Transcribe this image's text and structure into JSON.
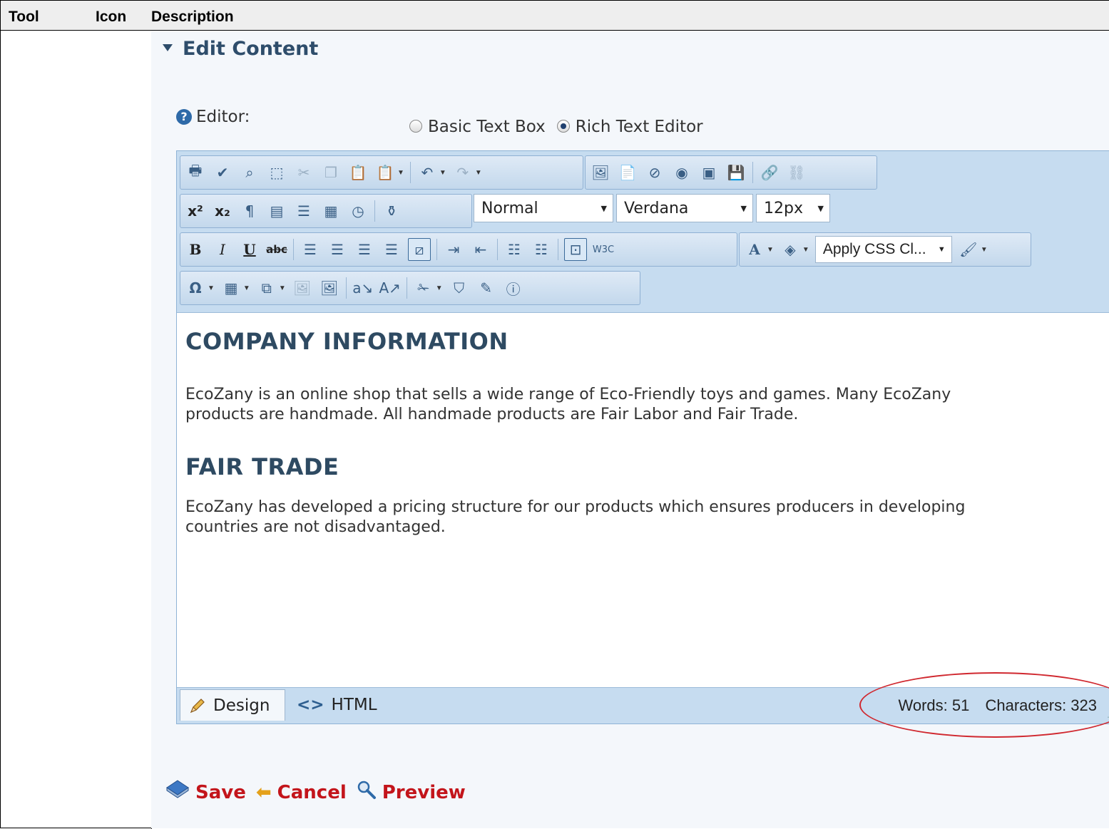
{
  "doc_table": {
    "headers": {
      "tool": "Tool",
      "icon": "Icon",
      "description": "Description"
    }
  },
  "section": {
    "title": "Edit Content"
  },
  "editor_option": {
    "label": "Editor:",
    "options": [
      {
        "label": "Basic Text Box",
        "selected": false
      },
      {
        "label": "Rich Text Editor",
        "selected": true
      }
    ]
  },
  "toolbar": {
    "paragraph_style": "Normal",
    "font_name": "Verdana",
    "font_size": "12px",
    "css_class": "Apply CSS Cl...",
    "bold_label": "B",
    "italic_label": "I",
    "underline_label": "U",
    "strike_label": "abc",
    "font_color_label": "A",
    "omega_label": "Ω"
  },
  "content": {
    "heading1": "COMPANY INFORMATION",
    "para1_line1": "EcoZany is an online shop that sells a wide range of Eco-Friendly toys and games. Many EcoZany",
    "para1_line2": "products are handmade. All handmade products are Fair Labor and Fair Trade.",
    "heading2": "FAIR TRADE",
    "para2_line1": "EcoZany has developed a pricing structure for our products which ensures producers in developing",
    "para2_line2": "countries are not disadvantaged."
  },
  "bottom_bar": {
    "design_label": "Design",
    "html_label": "HTML",
    "words": "Words: 51",
    "characters": "Characters: 323"
  },
  "actions": {
    "save": "Save",
    "cancel": "Cancel",
    "preview": "Preview"
  },
  "colors": {
    "annotation": "#d0282f",
    "action_text": "#c3151b",
    "heading": "#2e4a62",
    "toolbar_bg": "#c6dcf0"
  }
}
